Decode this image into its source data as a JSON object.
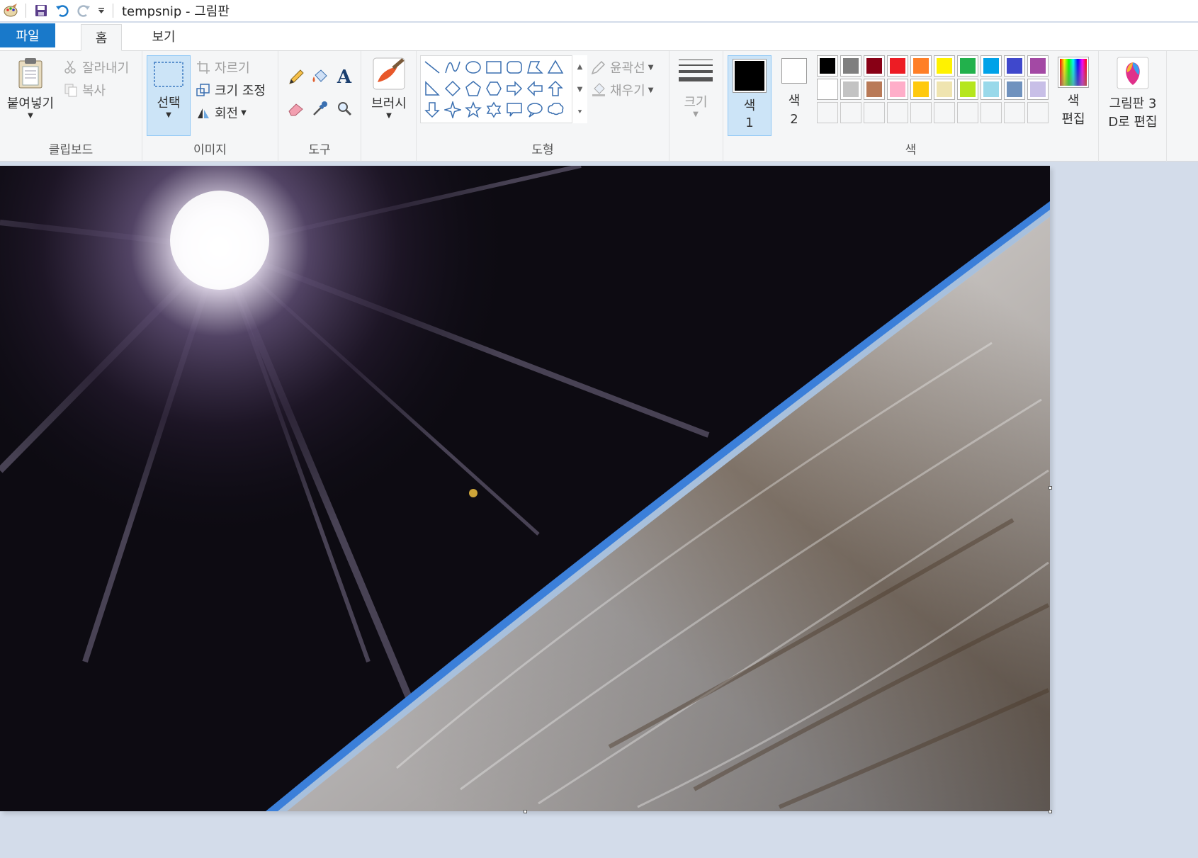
{
  "window": {
    "title": "tempsnip - 그림판"
  },
  "quick_access": {
    "icons": [
      "paint-app-icon",
      "save-icon",
      "undo-icon",
      "redo-icon",
      "customize-dropdown-icon"
    ]
  },
  "tabs": [
    {
      "label": "파일"
    },
    {
      "label": "홈"
    },
    {
      "label": "보기"
    }
  ],
  "ribbon": {
    "clipboard": {
      "label": "클립보드",
      "paste": "붙여넣기",
      "cut": "잘라내기",
      "copy": "복사"
    },
    "image": {
      "label": "이미지",
      "select": "선택",
      "crop": "자르기",
      "resize": "크기 조정",
      "rotate": "회전"
    },
    "tools": {
      "label": "도구"
    },
    "brushes": {
      "label": "브러시"
    },
    "shapes": {
      "label": "도형",
      "outline": "윤곽선",
      "fill": "채우기"
    },
    "size": {
      "label": "크기"
    },
    "colors": {
      "label": "색",
      "color1": "색",
      "color1_num": "1",
      "color2": "색",
      "color2_num": "2",
      "edit_colors_line1": "색",
      "edit_colors_line2": "편집",
      "color1_value": "#000000",
      "color2_value": "#ffffff",
      "palette_row1": [
        "#000000",
        "#7f7f7f",
        "#880015",
        "#ed1c24",
        "#ff7f27",
        "#fff200",
        "#22b14c",
        "#00a2e8",
        "#3f48cc",
        "#a349a4"
      ],
      "palette_row2": [
        "#ffffff",
        "#c3c3c3",
        "#b97a57",
        "#ffaec9",
        "#ffc90e",
        "#efe4b0",
        "#b5e61d",
        "#99d9ea",
        "#7092be",
        "#c8bfe7"
      ]
    },
    "paint3d": {
      "line1": "그림판 3",
      "line2": "D로 편집"
    }
  }
}
